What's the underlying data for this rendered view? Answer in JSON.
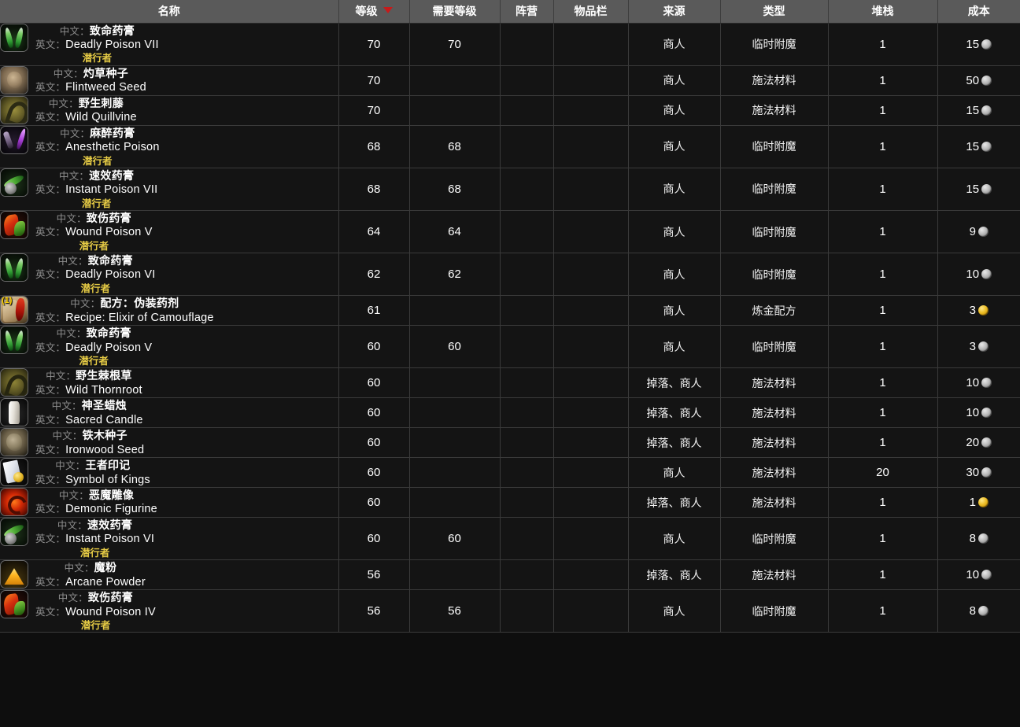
{
  "table": {
    "columns": [
      {
        "key": "name",
        "label": "名称",
        "sorted": false
      },
      {
        "key": "level",
        "label": "等级",
        "sorted": true,
        "sort_direction": "desc"
      },
      {
        "key": "req_level",
        "label": "需要等级",
        "sorted": false
      },
      {
        "key": "faction",
        "label": "阵营",
        "sorted": false
      },
      {
        "key": "slot",
        "label": "物品栏",
        "sorted": false
      },
      {
        "key": "source",
        "label": "来源",
        "sorted": false
      },
      {
        "key": "type",
        "label": "类型",
        "sorted": false
      },
      {
        "key": "stack",
        "label": "堆栈",
        "sorted": false
      },
      {
        "key": "cost",
        "label": "成本",
        "sorted": false
      }
    ],
    "labels": {
      "chinese": "中文：",
      "english": "英文："
    },
    "colors": {
      "header_bg": "#5a5a5a",
      "row_bg": "#141414",
      "grid_line": "#3a3a3a",
      "class_tag": "#e6cb45",
      "sort_arrow": "#c61b1b",
      "silver_coin": "#bdbdbd",
      "gold_coin": "#ecbd26"
    },
    "rows": [
      {
        "icon": "deadly-poison-icon",
        "art": "art-deadly",
        "count": "",
        "name_cn": "致命药膏",
        "name_en": "Deadly Poison VII",
        "class_tag": "潜行者",
        "level": "70",
        "req_level": "70",
        "faction": "",
        "slot": "",
        "source": "商人",
        "type": "临时附魔",
        "stack": "1",
        "cost_value": "15",
        "cost_coin": "silver"
      },
      {
        "icon": "flintweed-seed-icon",
        "art": "art-seed",
        "count": "",
        "name_cn": "灼草种子",
        "name_en": "Flintweed Seed",
        "class_tag": "",
        "level": "70",
        "req_level": "",
        "faction": "",
        "slot": "",
        "source": "商人",
        "type": "施法材料",
        "stack": "1",
        "cost_value": "50",
        "cost_coin": "silver"
      },
      {
        "icon": "wild-quillvine-icon",
        "art": "art-quill",
        "count": "",
        "name_cn": "野生刺藤",
        "name_en": "Wild Quillvine",
        "class_tag": "",
        "level": "70",
        "req_level": "",
        "faction": "",
        "slot": "",
        "source": "商人",
        "type": "施法材料",
        "stack": "1",
        "cost_value": "15",
        "cost_coin": "silver"
      },
      {
        "icon": "anesthetic-poison-icon",
        "art": "art-anesthetic",
        "count": "",
        "name_cn": "麻醉药膏",
        "name_en": "Anesthetic Poison",
        "class_tag": "潜行者",
        "level": "68",
        "req_level": "68",
        "faction": "",
        "slot": "",
        "source": "商人",
        "type": "临时附魔",
        "stack": "1",
        "cost_value": "15",
        "cost_coin": "silver"
      },
      {
        "icon": "instant-poison-icon",
        "art": "art-instant",
        "count": "",
        "name_cn": "速效药膏",
        "name_en": "Instant Poison VII",
        "class_tag": "潜行者",
        "level": "68",
        "req_level": "68",
        "faction": "",
        "slot": "",
        "source": "商人",
        "type": "临时附魔",
        "stack": "1",
        "cost_value": "15",
        "cost_coin": "silver"
      },
      {
        "icon": "wound-poison-icon",
        "art": "art-wound",
        "count": "",
        "name_cn": "致伤药膏",
        "name_en": "Wound Poison V",
        "class_tag": "潜行者",
        "level": "64",
        "req_level": "64",
        "faction": "",
        "slot": "",
        "source": "商人",
        "type": "临时附魔",
        "stack": "1",
        "cost_value": "9",
        "cost_coin": "silver"
      },
      {
        "icon": "deadly-poison-icon",
        "art": "art-deadly",
        "count": "",
        "name_cn": "致命药膏",
        "name_en": "Deadly Poison VI",
        "class_tag": "潜行者",
        "level": "62",
        "req_level": "62",
        "faction": "",
        "slot": "",
        "source": "商人",
        "type": "临时附魔",
        "stack": "1",
        "cost_value": "10",
        "cost_coin": "silver"
      },
      {
        "icon": "recipe-scroll-icon",
        "art": "art-recipe",
        "count": "(1)",
        "name_cn": "配方：伪装药剂",
        "name_en": "Recipe: Elixir of Camouflage",
        "class_tag": "",
        "level": "61",
        "req_level": "",
        "faction": "",
        "slot": "",
        "source": "商人",
        "type": "炼金配方",
        "stack": "1",
        "cost_value": "3",
        "cost_coin": "gold"
      },
      {
        "icon": "deadly-poison-icon",
        "art": "art-deadly",
        "count": "",
        "name_cn": "致命药膏",
        "name_en": "Deadly Poison V",
        "class_tag": "潜行者",
        "level": "60",
        "req_level": "60",
        "faction": "",
        "slot": "",
        "source": "商人",
        "type": "临时附魔",
        "stack": "1",
        "cost_value": "3",
        "cost_coin": "silver"
      },
      {
        "icon": "wild-thornroot-icon",
        "art": "art-thornroot",
        "count": "",
        "name_cn": "野生棘根草",
        "name_en": "Wild Thornroot",
        "class_tag": "",
        "level": "60",
        "req_level": "",
        "faction": "",
        "slot": "",
        "source": "掉落、商人",
        "type": "施法材料",
        "stack": "1",
        "cost_value": "10",
        "cost_coin": "silver"
      },
      {
        "icon": "sacred-candle-icon",
        "art": "art-candle",
        "count": "",
        "name_cn": "神圣蜡烛",
        "name_en": "Sacred Candle",
        "class_tag": "",
        "level": "60",
        "req_level": "",
        "faction": "",
        "slot": "",
        "source": "掉落、商人",
        "type": "施法材料",
        "stack": "1",
        "cost_value": "10",
        "cost_coin": "silver"
      },
      {
        "icon": "ironwood-seed-icon",
        "art": "art-ironwood",
        "count": "",
        "name_cn": "铁木种子",
        "name_en": "Ironwood Seed",
        "class_tag": "",
        "level": "60",
        "req_level": "",
        "faction": "",
        "slot": "",
        "source": "掉落、商人",
        "type": "施法材料",
        "stack": "1",
        "cost_value": "20",
        "cost_coin": "silver"
      },
      {
        "icon": "symbol-of-kings-icon",
        "art": "art-symbol",
        "count": "",
        "name_cn": "王者印记",
        "name_en": "Symbol of Kings",
        "class_tag": "",
        "level": "60",
        "req_level": "",
        "faction": "",
        "slot": "",
        "source": "商人",
        "type": "施法材料",
        "stack": "20",
        "cost_value": "30",
        "cost_coin": "silver"
      },
      {
        "icon": "demonic-figurine-icon",
        "art": "art-figurine",
        "count": "",
        "name_cn": "恶魔雕像",
        "name_en": "Demonic Figurine",
        "class_tag": "",
        "level": "60",
        "req_level": "",
        "faction": "",
        "slot": "",
        "source": "掉落、商人",
        "type": "施法材料",
        "stack": "1",
        "cost_value": "1",
        "cost_coin": "gold"
      },
      {
        "icon": "instant-poison-icon",
        "art": "art-instant",
        "count": "",
        "name_cn": "速效药膏",
        "name_en": "Instant Poison VI",
        "class_tag": "潜行者",
        "level": "60",
        "req_level": "60",
        "faction": "",
        "slot": "",
        "source": "商人",
        "type": "临时附魔",
        "stack": "1",
        "cost_value": "8",
        "cost_coin": "silver"
      },
      {
        "icon": "arcane-powder-icon",
        "art": "art-powder",
        "count": "",
        "name_cn": "魔粉",
        "name_en": "Arcane Powder",
        "class_tag": "",
        "level": "56",
        "req_level": "",
        "faction": "",
        "slot": "",
        "source": "掉落、商人",
        "type": "施法材料",
        "stack": "1",
        "cost_value": "10",
        "cost_coin": "silver"
      },
      {
        "icon": "wound-poison-icon",
        "art": "art-wound",
        "count": "",
        "name_cn": "致伤药膏",
        "name_en": "Wound Poison IV",
        "class_tag": "潜行者",
        "level": "56",
        "req_level": "56",
        "faction": "",
        "slot": "",
        "source": "商人",
        "type": "临时附魔",
        "stack": "1",
        "cost_value": "8",
        "cost_coin": "silver"
      }
    ]
  }
}
